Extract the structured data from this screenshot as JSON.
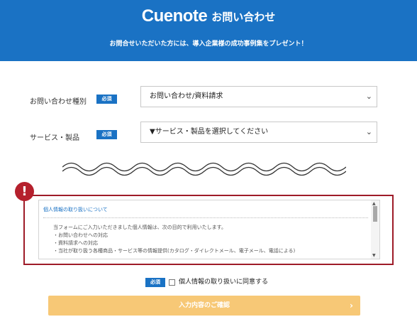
{
  "header": {
    "logo": "Cuenote",
    "page_title": "お問い合わせ",
    "tagline": "お問合せいただいた方には、導入企業様の成功事例集をプレゼント！",
    "background_color": "#1a72c4"
  },
  "form": {
    "required_badge": "必須",
    "inquiry_type": {
      "label": "お問い合わせ種別",
      "selected": "お問い合わせ/資料請求"
    },
    "service": {
      "label": "サービス・製品",
      "selected": "▼サービス・製品を選択してください"
    }
  },
  "privacy": {
    "title": "個人情報の取り扱いについて",
    "lines": [
      "当フォームにご入力いただきました個人情報は、次の目的で利用いたします。",
      "・お問い合わせへの対応",
      "・資料請求への対応",
      "・当社が取り扱う各種商品・サービス等の情報提供(カタログ・ダイレクトメール、電子メール、電話による)"
    ],
    "warning_mark": "!",
    "highlight_color": "#9e1b28"
  },
  "agree": {
    "badge": "必須",
    "label": "個人情報の取り扱いに同意する",
    "checked": false
  },
  "submit": {
    "label": "入力内容のご確認",
    "arrow": "›",
    "color": "#f7c876"
  },
  "icons": {
    "select_chevron": "⌄",
    "scroll_up": "▲",
    "scroll_down": "▼"
  }
}
